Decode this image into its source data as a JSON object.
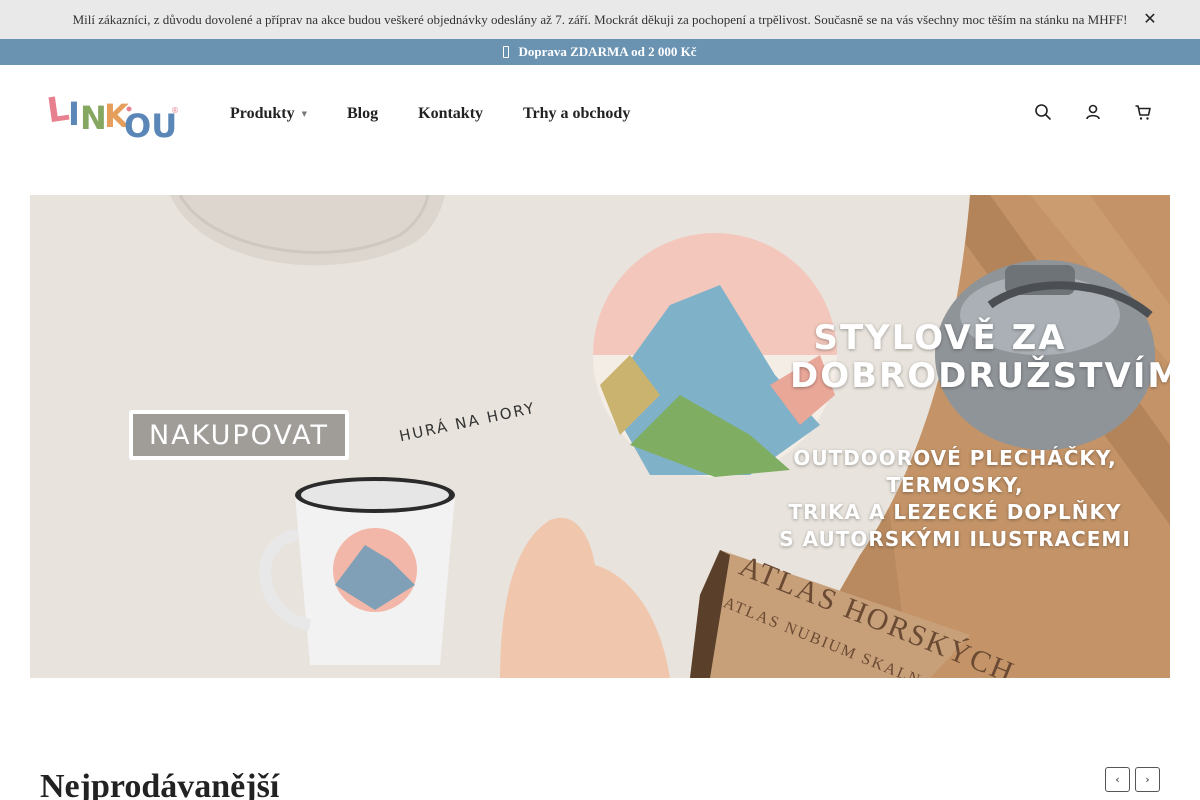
{
  "announcement": {
    "text": "Milí zákazníci, z důvodu dovolené a příprav na akce budou veškeré objednávky odeslány až 7. září. Mockrát děkuji za pochopení a trpělivost. Současně se na vás všechny moc těším na stánku na MHFF!",
    "close_label": "✕"
  },
  "shipping": {
    "text": "Doprava ZDARMA od 2 000 Kč"
  },
  "logo": {
    "text": "LINK·OU"
  },
  "nav": {
    "items": [
      {
        "label": "Produkty",
        "caret": "▼"
      },
      {
        "label": "Blog"
      },
      {
        "label": "Kontakty"
      },
      {
        "label": "Trhy a obchody"
      }
    ]
  },
  "header_icons": [
    "search-icon",
    "account-icon",
    "cart-icon"
  ],
  "hero": {
    "cta_label": "NAKUPOVAT",
    "title_lines": [
      "STYLOVĚ ZA",
      "DOBRODRUŽSTVÍM"
    ],
    "subtitle_lines": [
      "OUTDOOROVÉ PLECHÁČKY, TERMOSKY,",
      "TRIKA A LEZECKÉ DOPLŇKY",
      "S AUTORSKÝMI ILUSTRACEMI"
    ],
    "slogan": "HURÁ NA HORY",
    "book_title": "ATLAS HORSKÝCH",
    "book_subtitle": "ATLAS NUBIUM SKALNATÉ"
  },
  "bestsellers": {
    "title": "Nejprodávanější",
    "prev_label": "‹",
    "next_label": "›"
  },
  "colors": {
    "announcement_bg": "#e9e9e9",
    "shipping_bg": "#6a93b2",
    "logo_l": "#e7818f",
    "logo_i": "#5b87b8",
    "logo_n": "#86a760",
    "logo_k": "#e59e5b",
    "logo_ou": "#5b87b8"
  }
}
